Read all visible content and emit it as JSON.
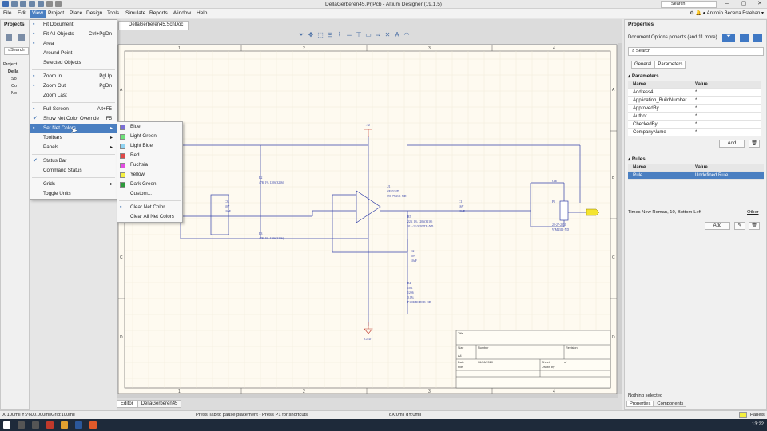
{
  "window": {
    "title": "DellaGerberen45.PrjPcb - Altium Designer (19.1.5)",
    "search_placeholder": "Search"
  },
  "menubar": {
    "items": [
      "File",
      "Edit",
      "View",
      "Project",
      "Place",
      "Design",
      "Tools",
      "Simulate",
      "Reports",
      "Window",
      "Help"
    ],
    "active": "View",
    "user": "Antonio Becerra Esteban"
  },
  "projects_panel": {
    "title": "Projects",
    "search_placeholder": "Search",
    "tree_items": [
      "Project",
      "Della",
      "So",
      "Co",
      "No"
    ]
  },
  "document": {
    "tab": "DellaGerberen45.SchDoc",
    "editor_tabs": [
      "Editor",
      "DellaGerberen45"
    ]
  },
  "view_menu": {
    "items": [
      {
        "label": "Fit Document",
        "shortcut": "",
        "icon": "fit-document-icon"
      },
      {
        "label": "Fit All Objects",
        "shortcut": "Ctrl+PgDn",
        "icon": "fit-all-icon"
      },
      {
        "label": "Area",
        "shortcut": "",
        "icon": "area-icon"
      },
      {
        "label": "Around Point",
        "shortcut": "",
        "icon": ""
      },
      {
        "label": "Selected Objects",
        "shortcut": "",
        "icon": ""
      },
      {
        "sep": true
      },
      {
        "label": "Zoom In",
        "shortcut": "PgUp",
        "icon": "zoom-in-icon"
      },
      {
        "label": "Zoom Out",
        "shortcut": "PgDn",
        "icon": "zoom-out-icon"
      },
      {
        "label": "Zoom Last",
        "shortcut": "",
        "icon": ""
      },
      {
        "sep": true
      },
      {
        "label": "Full Screen",
        "shortcut": "Alt+F5",
        "icon": "full-screen-icon"
      },
      {
        "label": "Show Net Color Override",
        "shortcut": "F5",
        "icon": "check-icon"
      },
      {
        "label": "Set Net Colors",
        "shortcut": "",
        "icon": "net-color-icon",
        "submenu": true,
        "highlight": true
      },
      {
        "label": "Toolbars",
        "shortcut": "",
        "icon": "",
        "submenu": true
      },
      {
        "label": "Panels",
        "shortcut": "",
        "icon": "",
        "submenu": true
      },
      {
        "sep": true
      },
      {
        "label": "Status Bar",
        "shortcut": "",
        "icon": "check-icon"
      },
      {
        "label": "Command Status",
        "shortcut": "",
        "icon": ""
      },
      {
        "sep": true
      },
      {
        "label": "Grids",
        "shortcut": "",
        "icon": "",
        "submenu": true
      },
      {
        "label": "Toggle Units",
        "shortcut": "",
        "icon": ""
      }
    ]
  },
  "color_menu": {
    "items": [
      {
        "label": "Blue",
        "color": "#7b6fd6"
      },
      {
        "label": "Light Green",
        "color": "#6ee07a"
      },
      {
        "label": "Light Blue",
        "color": "#8fd3f2"
      },
      {
        "label": "Red",
        "color": "#e04848"
      },
      {
        "label": "Fuchsia",
        "color": "#e04ce0"
      },
      {
        "label": "Yellow",
        "color": "#f4f040"
      },
      {
        "label": "Dark Green",
        "color": "#2c9a3a"
      },
      {
        "label": "Custom...",
        "color": ""
      },
      {
        "sep": true
      },
      {
        "label": "Clear Net Color",
        "color": "",
        "icon": "clear-net-icon"
      },
      {
        "label": "Clear All Net Colors",
        "color": "",
        "icon": ""
      }
    ]
  },
  "properties": {
    "title": "Properties",
    "document_options": "Document Options",
    "components_label": "ponents (and 11 more)",
    "search_placeholder": "Search",
    "tabs": [
      "General",
      "Parameters"
    ],
    "parameters_header": "Parameters",
    "param_cols": [
      "Name",
      "Value"
    ],
    "params": [
      {
        "name": "Address4",
        "value": "*"
      },
      {
        "name": "Application_BuildNumber",
        "value": "*"
      },
      {
        "name": "ApprovedBy",
        "value": "*"
      },
      {
        "name": "Author",
        "value": "*"
      },
      {
        "name": "CheckedBy",
        "value": "*"
      },
      {
        "name": "CompanyName",
        "value": "*"
      }
    ],
    "add_label": "Add",
    "rules_header": "Rules",
    "rule_cols": [
      "Name",
      "Value"
    ],
    "rules": [
      {
        "name": "Rule",
        "value": "Undefined Rule"
      }
    ],
    "font_info": "Times New Roman, 10, Bottom-Left",
    "other_label": "Other",
    "rules_add_label": "Add",
    "nothing_selected": "Nothing selected",
    "bottom_tabs": [
      "Properties",
      "Components"
    ]
  },
  "statusbar": {
    "coords": "X:100mil Y:7600.000mil",
    "grid": "Grid:100mil",
    "hint": "Press Tab to pause placement - Press P1 for shortcuts",
    "delta": "dX:0mil dY:0mil",
    "panels_label": "Panels"
  },
  "taskbar": {
    "time": "13:22"
  },
  "schematic": {
    "col_labels": [
      "1",
      "2",
      "3",
      "4"
    ],
    "row_labels": [
      "A",
      "B",
      "C",
      "D"
    ],
    "vcc": "+12",
    "gnd": "GND",
    "u1": "U1",
    "u1_part": "NE5534D",
    "u1_pkg": "296-7543-1-ND",
    "r2": "R2",
    "r2_val": "47K 1% 1206(3216)",
    "r3": "R3",
    "r3_val": "47K 1% 1206(3216)",
    "r5": "R5",
    "r5_val": "22K 1% 1206(3216)",
    "r5_part": "311-22.0KFRTR-ND",
    "c1": "C1",
    "c1_vals": [
      "16V",
      "10uF"
    ],
    "c2": "C2",
    "c2_vals": [
      "50V",
      "10uF"
    ],
    "c3": "C3",
    "c3_vals": [
      "50V",
      "10uF"
    ],
    "r4": "R4",
    "r4_vals": [
      "10K",
      "1206",
      "0.1%",
      "P1.0KBCDKR-ND"
    ],
    "p1": "P1",
    "p1_part": "22-27-2031",
    "p1_part2": "WM4311-ND",
    "out_label": "Out",
    "title_block": {
      "title": "Title",
      "size": "Size",
      "size_val": "A4",
      "number": "Number",
      "revision": "Revision",
      "date": "Date",
      "date_val": "06/06/2020",
      "file": "File",
      "sheet": "Sheet",
      "of": "of",
      "drawn": "Drawn By"
    }
  }
}
